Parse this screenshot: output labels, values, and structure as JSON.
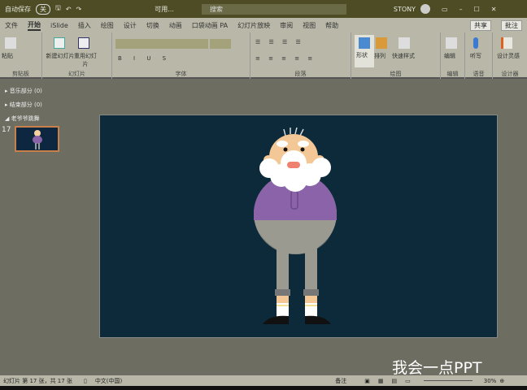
{
  "titlebar": {
    "autosave": "自动保存",
    "autosave_state": "关",
    "doc_title": "可用...",
    "search_placeholder": "搜索",
    "user": "STONY"
  },
  "tabs": [
    "文件",
    "开始",
    "iSlide",
    "插入",
    "绘图",
    "设计",
    "切换",
    "动画",
    "口袋动画 PA",
    "幻灯片放映",
    "审阅",
    "视图",
    "帮助"
  ],
  "active_tab": "开始",
  "share": "共享",
  "comment": "批注",
  "ribbon": {
    "groups": [
      "剪贴板",
      "幻灯片",
      "字体",
      "段落",
      "绘图",
      "编辑",
      "语音",
      "设计器"
    ],
    "buttons": {
      "paste": "粘贴",
      "new_slide": "新建幻灯片",
      "reuse": "重用幻灯片",
      "shapes": "形状",
      "arrange": "排列",
      "quick_styles": "快速样式",
      "find": "编辑",
      "dictate": "听写",
      "designer": "设计灵感"
    }
  },
  "panel": {
    "sections": [
      {
        "label": "音乐部分 (0)"
      },
      {
        "label": "结束部分 (0)"
      },
      {
        "label": "老爷爷跳舞"
      }
    ],
    "slide_number": "17"
  },
  "status": {
    "slide_info": "幻灯片 第 17 张，共 17 张",
    "language": "中文(中国)",
    "notes": "备注",
    "zoom": "30%"
  },
  "watermark": "我会一点PPT",
  "colors": {
    "titlebar": "#4d4c25",
    "ribbon": "#b9b8a8",
    "slide_bg": "#0d2a3a",
    "shirt": "#8a63a8"
  }
}
